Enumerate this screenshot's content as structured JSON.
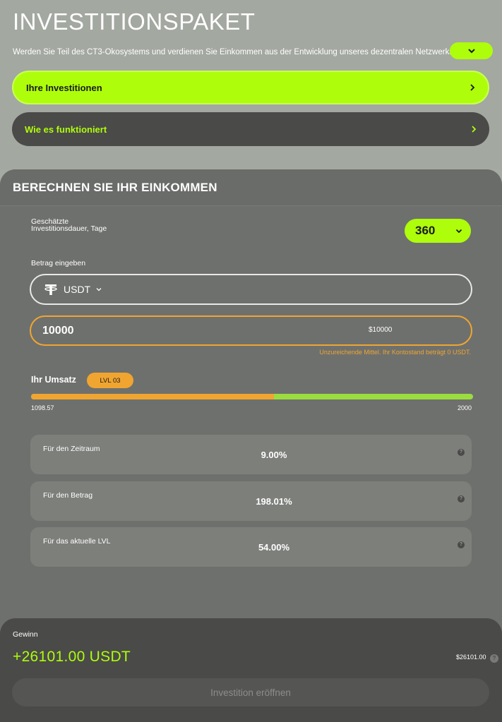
{
  "header": {
    "title": "INVESTITIONSPAKET",
    "subtitle": "Werden Sie Teil des CT3-Ökosystems und verdienen Sie Einkommen aus der Entwicklung unseres dezentralen Netzwerks",
    "expand_icon": "chevron-down-icon"
  },
  "nav": {
    "investments_label": "Ihre Investitionen",
    "how_it_works_label": "Wie es funktioniert"
  },
  "calculator": {
    "title": "BERECHNEN SIE IHR EINKOMMEN",
    "duration_label": "Geschätzte Investitionsdauer, Tage",
    "duration_value": "360",
    "amount_label": "Betrag eingeben",
    "currency": "USDT",
    "amount_value": "10000",
    "amount_usd": "$10000",
    "error_text": "Unzureichende Mittel. Ihr Kontostand beträgt 0 USDT.",
    "turnover_label": "Ihr Umsatz",
    "level_badge": "LVL 03",
    "turnover_current": "1098.57",
    "turnover_max": "2000",
    "turnover_fraction": 0.549
  },
  "cards": [
    {
      "label": "Für den Zeitraum",
      "value": "9.00%"
    },
    {
      "label": "Für den Betrag",
      "value": "198.01%"
    },
    {
      "label": "Für das aktuelle LVL",
      "value": "54.00%"
    }
  ],
  "profit": {
    "label": "Gewinn",
    "value": "+26101.00 USDT",
    "usd": "$26101.00",
    "button_label": "Investition eröffnen"
  },
  "colors": {
    "accent": "#aefe0b",
    "warning": "#f0a531",
    "panel": "#6e706d"
  }
}
